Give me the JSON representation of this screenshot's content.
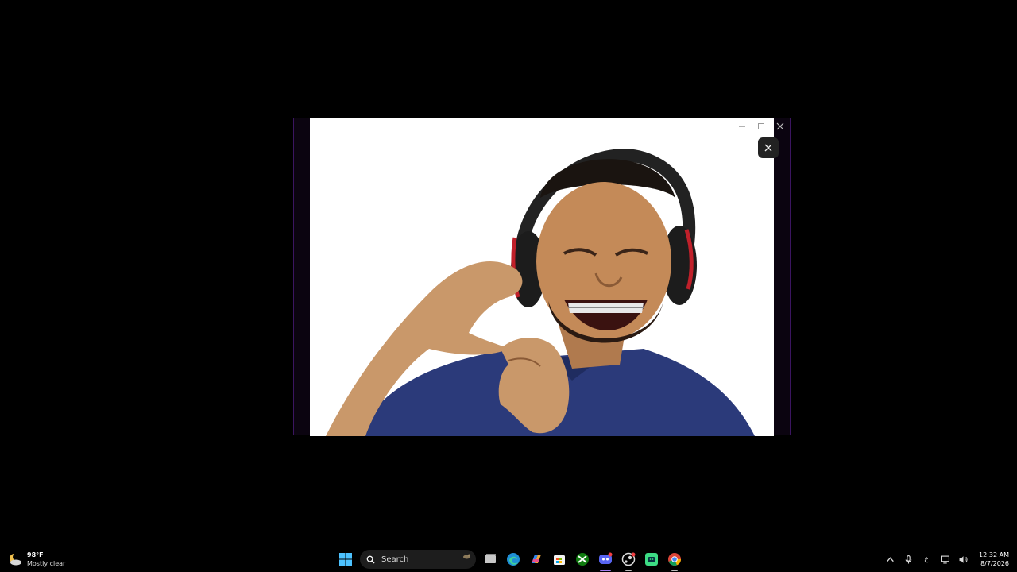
{
  "window": {
    "controls": [
      "minimize",
      "maximize",
      "close"
    ]
  },
  "viewer": {
    "close_icon": "close-icon"
  },
  "taskbar": {
    "weather": {
      "temperature": "98°F",
      "condition": "Mostly clear",
      "icon": "moon-cloud-icon"
    },
    "search": {
      "label": "Search"
    },
    "apps": [
      "start-icon",
      "task-view-icon",
      "edge-icon",
      "copilot-icon",
      "store-icon",
      "xbox-icon",
      "discord-icon",
      "steam-icon",
      "android-app-icon",
      "chrome-icon"
    ],
    "language": "ع",
    "clock": {
      "time": "12:32 AM",
      "date": "8/7/2026"
    }
  },
  "colors": {
    "window_border": "#3b1560",
    "active_indicator": "#a77ff0",
    "shirt": "#2a3a78",
    "headphones_red": "#c0202a"
  }
}
